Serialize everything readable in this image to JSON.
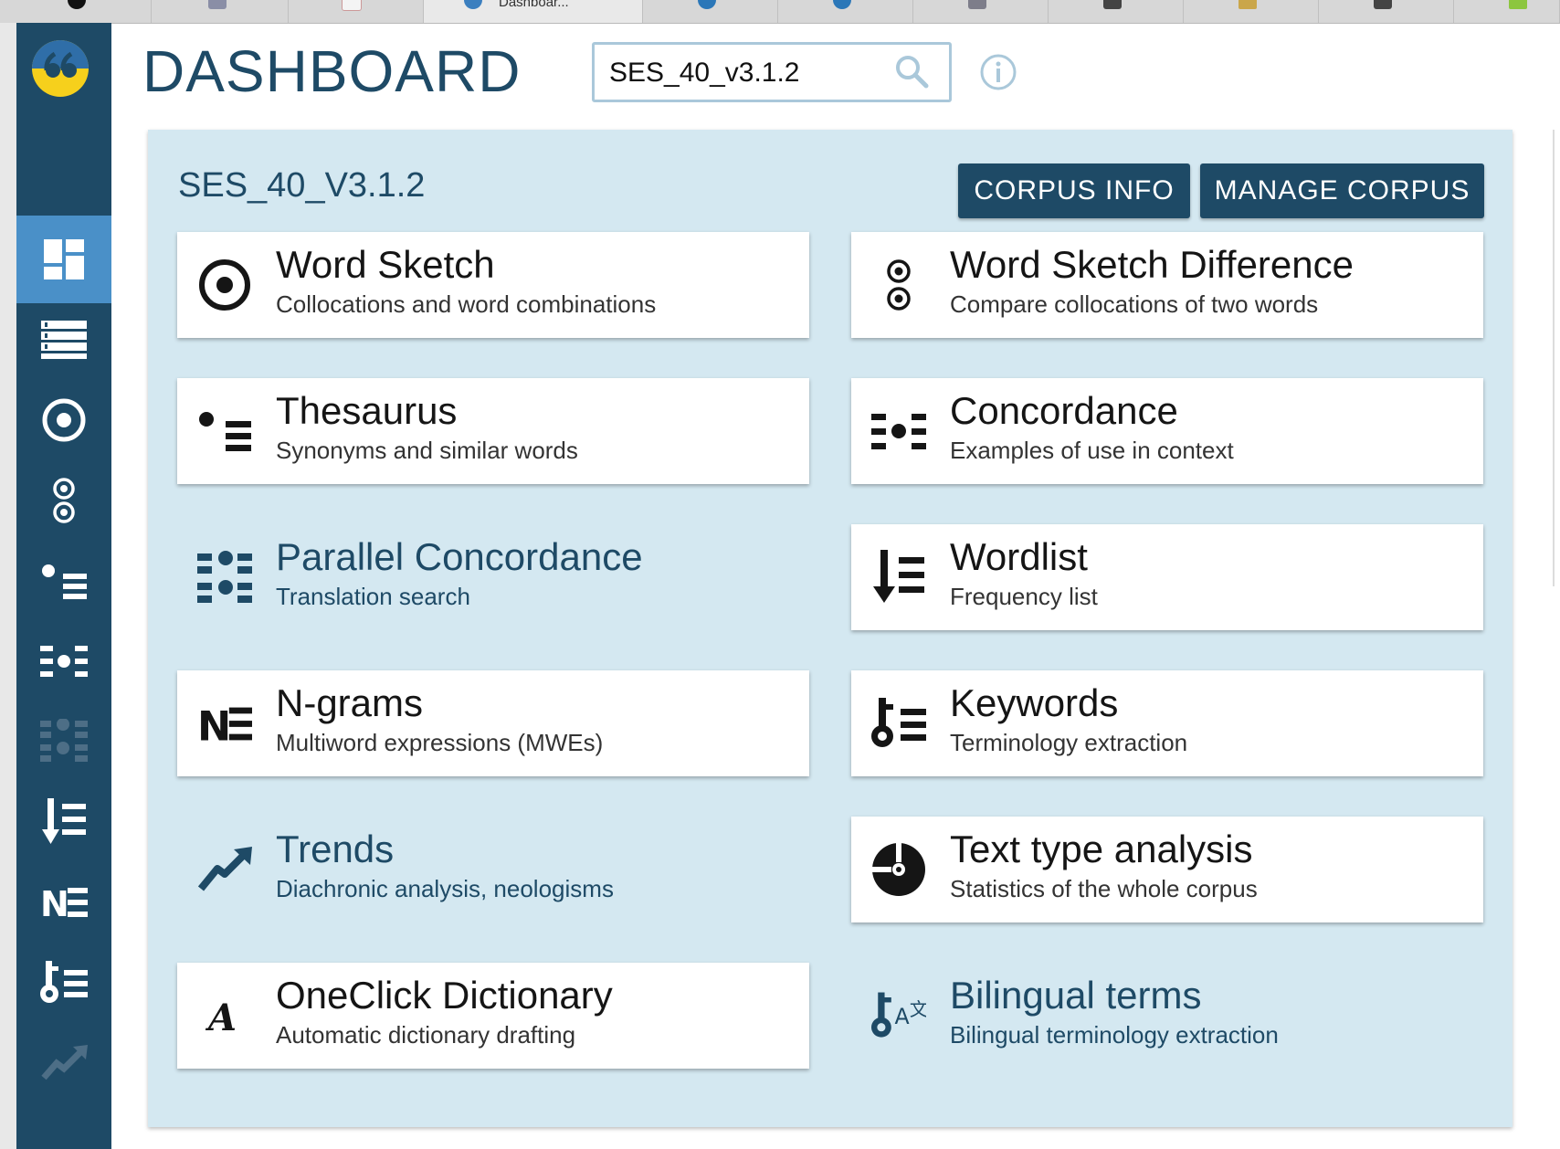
{
  "browser": {
    "active_tab_label": "Dashboar..."
  },
  "sidebar": {
    "items": [
      {
        "name": "dashboard",
        "active": true
      },
      {
        "name": "corpus-list"
      },
      {
        "name": "word-sketch"
      },
      {
        "name": "word-sketch-difference"
      },
      {
        "name": "thesaurus"
      },
      {
        "name": "concordance"
      },
      {
        "name": "parallel-concordance",
        "disabled": true
      },
      {
        "name": "wordlist"
      },
      {
        "name": "ngrams"
      },
      {
        "name": "keywords"
      },
      {
        "name": "trends"
      }
    ]
  },
  "header": {
    "title": "DASHBOARD",
    "search_value": "SES_40_v3.1.2"
  },
  "panel": {
    "corpus_name": "SES_40_V3.1.2",
    "corpus_info_label": "CORPUS INFO",
    "manage_corpus_label": "MANAGE CORPUS"
  },
  "tools": [
    {
      "title": "Word Sketch",
      "subtitle": "Collocations and word combinations",
      "icon": "word-sketch-icon",
      "available": true
    },
    {
      "title": "Word Sketch Difference",
      "subtitle": "Compare collocations of two words",
      "icon": "word-sketch-difference-icon",
      "available": true
    },
    {
      "title": "Thesaurus",
      "subtitle": "Synonyms and similar words",
      "icon": "thesaurus-icon",
      "available": true
    },
    {
      "title": "Concordance",
      "subtitle": "Examples of use in context",
      "icon": "concordance-icon",
      "available": true
    },
    {
      "title": "Parallel Concordance",
      "subtitle": "Translation search",
      "icon": "parallel-concordance-icon",
      "available": false
    },
    {
      "title": "Wordlist",
      "subtitle": "Frequency list",
      "icon": "wordlist-icon",
      "available": true
    },
    {
      "title": "N-grams",
      "subtitle": "Multiword expressions (MWEs)",
      "icon": "ngrams-icon",
      "available": true
    },
    {
      "title": "Keywords",
      "subtitle": "Terminology extraction",
      "icon": "keywords-icon",
      "available": true
    },
    {
      "title": "Trends",
      "subtitle": "Diachronic analysis, neologisms",
      "icon": "trends-icon",
      "available": false
    },
    {
      "title": "Text type analysis",
      "subtitle": "Statistics of the whole corpus",
      "icon": "text-type-analysis-icon",
      "available": true
    },
    {
      "title": "OneClick Dictionary",
      "subtitle": "Automatic dictionary drafting",
      "icon": "oneclick-dictionary-icon",
      "available": true
    },
    {
      "title": "Bilingual terms",
      "subtitle": "Bilingual terminology extraction",
      "icon": "bilingual-terms-icon",
      "available": false
    }
  ],
  "colors": {
    "sidebar_bg": "#1e4a66",
    "sidebar_active": "#4a90c8",
    "panel_bg": "#d4e8f1",
    "title": "#1e4a66",
    "button_bg": "#1e4a66"
  }
}
